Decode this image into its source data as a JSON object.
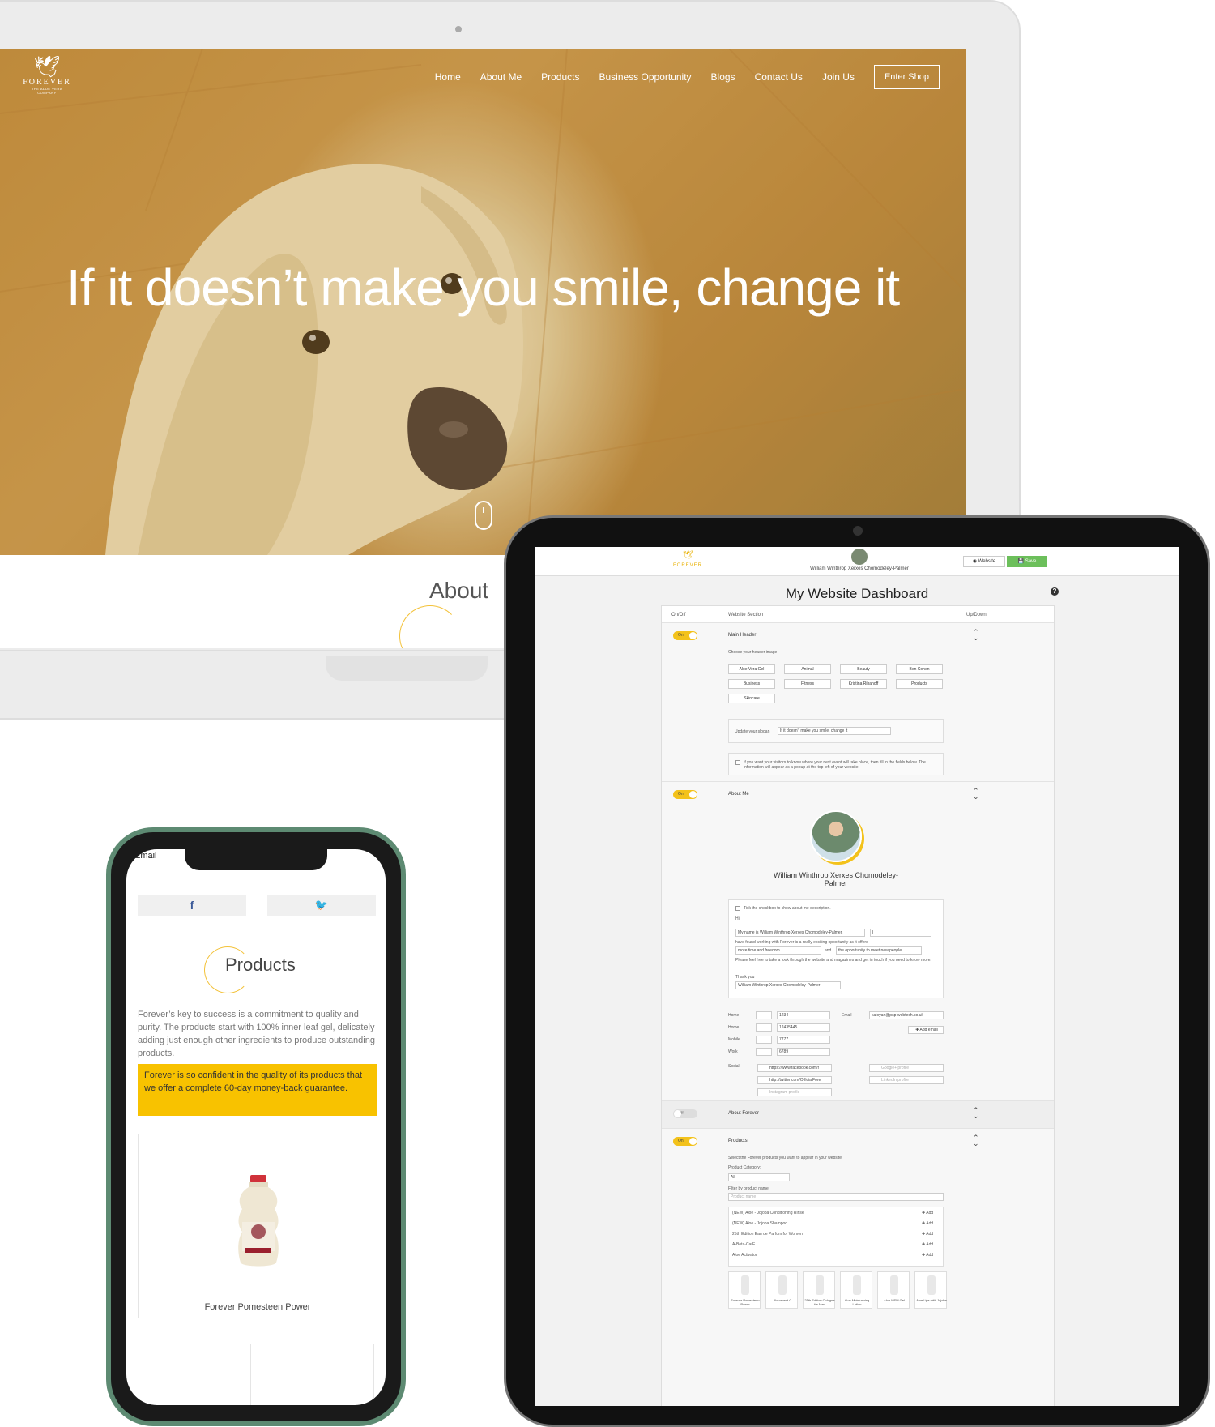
{
  "site": {
    "logo_brand": "FOREVER",
    "logo_sub": "THE ALOE VERA COMPANY",
    "nav": [
      "Home",
      "About Me",
      "Products",
      "Business Opportunity",
      "Blogs",
      "Contact Us",
      "Join Us"
    ],
    "enter_shop": "Enter Shop",
    "slogan": "If it doesn’t make you smile, change it",
    "about_title": "About"
  },
  "dashboard": {
    "logo_brand": "FOREVER",
    "user_name": "William Winthrop Xerxes Chomodeley-Palmer",
    "website_button": "◉ Website",
    "save_button": "💾 Save",
    "title": "My Website Dashboard",
    "help": "?",
    "col_onoff": "On/Off",
    "col_section": "Website Section",
    "col_updown": "Up/Down",
    "sections": {
      "main_header": {
        "toggle": "On",
        "name": "Main Header",
        "choose": "Choose your header image",
        "images": [
          "Aloe Vera Gel",
          "Animal",
          "Beauty",
          "Ben Cohen",
          "Business",
          "Fitness",
          "Kristina Rihanoff",
          "Products",
          "Skincare"
        ],
        "slogan_label": "Update your slogan",
        "slogan_value": "If it doesn't make you smile, change it",
        "event_text": "If you want your visitors to know where your next event will take place, then fill in the fields below. The information will appear as a popup at the top left of your website."
      },
      "about_me": {
        "toggle": "On",
        "name": "About Me",
        "person": "William Winthrop Xerxes Chomodeley-Palmer",
        "tick_text": "Tick the checkbox to show about me description.",
        "hi": "Hi",
        "select1": "My name is William Winthrop Xerxes Chomodeley-Palmer,",
        "select2": "I",
        "line2": "have found working with Forever is a really exciting opportunity as it offers",
        "select3": "more time and freedom",
        "and": "and",
        "select4": "the opportunity to meet new people",
        "line3": "Please feel free to take a look through the website and magazines and get in touch if you need to know more.",
        "thank": "Thank you",
        "select5": "William Winthrop Xerxes Chomodeley-Palmer",
        "phones": [
          {
            "label": "Home",
            "value": "1234"
          },
          {
            "label": "Home",
            "value": "12435445"
          },
          {
            "label": "Mobile",
            "value": "7777"
          },
          {
            "label": "Work",
            "value": "6789"
          }
        ],
        "email_label": "Email",
        "email_value": "kaloyan@psp-webtech.co.uk",
        "add_email": "✚ Add email",
        "social_label": "Social",
        "facebook": "https://www.facebook.com/f",
        "twitter": "http://twitter.com/OfficialFore",
        "instagram": "Instagram profile",
        "google": "Google+ profile",
        "linkedin": "LinkedIn profile"
      },
      "about_forever": {
        "toggle": "Off",
        "name": "About Forever"
      },
      "products": {
        "toggle": "On",
        "name": "Products",
        "select_text": "Select the Forever products you want to appear in your website",
        "category_label": "Product Category:",
        "category_value": "All",
        "filter_label": "Filter by product name",
        "filter_placeholder": "Product name",
        "list": [
          "(NEW) Aloe - Jojoba Conditioning Rinse",
          "(NEW) Aloe - Jojoba Shampoo",
          "25th Edition Eau de Parfum for Women",
          "A-Beta-CarE",
          "Aloe Activator"
        ],
        "add": "✚ Add",
        "thumbs": [
          "Forever Pomesteen Power",
          "Absorbent-C",
          "25th Edition Cologne for Men",
          "Aloe Moisturizing Lotion",
          "Aloe MSM Gel",
          "Aloe Lips with Jojoba"
        ]
      }
    }
  },
  "phone": {
    "email_label": "Email",
    "facebook": "f",
    "twitter": "🐦",
    "products_title": "Products",
    "products_text": "Forever’s key to success is a commitment to quality and purity. The products start with 100% inner leaf gel, delicately adding just enough other ingredients to produce outstanding products.",
    "highlight": "Forever is so confident in the quality of its products that we offer a complete 60-day money-back guarantee.",
    "product_name": "Forever Pomesteen Power"
  },
  "colors": {
    "accent": "#f8c200",
    "save": "#6cbf5b",
    "phone_frame": "#5d8a72"
  }
}
